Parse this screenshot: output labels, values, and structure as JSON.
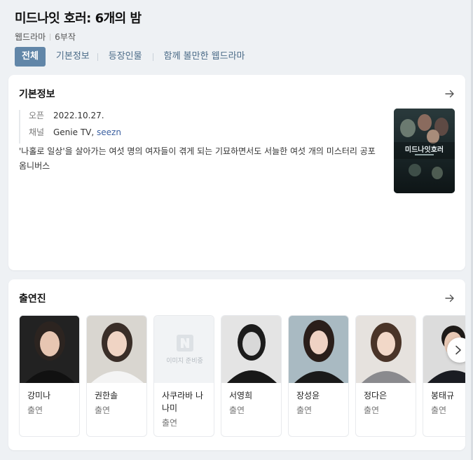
{
  "header": {
    "title": "미드나잇 호러: 6개의 밤",
    "genre": "웹드라마",
    "episodes": "6부작"
  },
  "tabs": [
    {
      "label": "전체",
      "active": true
    },
    {
      "label": "기본정보",
      "active": false
    },
    {
      "label": "등장인물",
      "active": false
    },
    {
      "label": "함께 볼만한 웹드라마",
      "active": false
    }
  ],
  "basic_info": {
    "title": "기본정보",
    "open_label": "오픈",
    "open_value": "2022.10.27.",
    "channel_label": "채널",
    "channel_primary": "Genie TV,",
    "channel_link": "seezn",
    "description": "'나홀로 일상'을 살아가는 여섯 명의 여자들이 겪게 되는 기묘하면서도 서늘한 여섯 개의 미스터리 공포 옴니버스",
    "poster_title": "미드나잇호러"
  },
  "cast": {
    "title": "출연진",
    "placeholder_text": "이미지 준비중",
    "members": [
      {
        "name": "강미나",
        "role": "출연",
        "photo": "portrait"
      },
      {
        "name": "권한솔",
        "role": "출연",
        "photo": "portrait"
      },
      {
        "name": "사쿠라바 나나미",
        "role": "출연",
        "photo": "placeholder"
      },
      {
        "name": "서영희",
        "role": "출연",
        "photo": "portrait"
      },
      {
        "name": "장성윤",
        "role": "출연",
        "photo": "portrait"
      },
      {
        "name": "정다은",
        "role": "출연",
        "photo": "portrait"
      },
      {
        "name": "봉태규",
        "role": "출연",
        "photo": "portrait"
      }
    ]
  },
  "icons": {
    "arrow": "arrow-right-icon",
    "next": "chevron-right-icon",
    "placeholder_logo": "naver-n-icon"
  },
  "colors": {
    "accent": "#6186a8",
    "link": "#3a5fa0",
    "background": "#eef1f4"
  }
}
